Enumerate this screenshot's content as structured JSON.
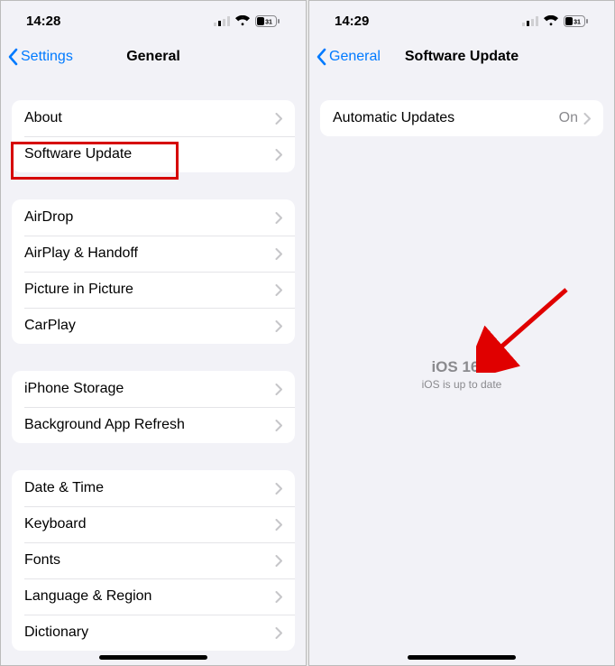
{
  "left": {
    "status": {
      "time": "14:28"
    },
    "nav": {
      "back": "Settings",
      "title": "General"
    },
    "groups": [
      [
        "About",
        "Software Update"
      ],
      [
        "AirDrop",
        "AirPlay & Handoff",
        "Picture in Picture",
        "CarPlay"
      ],
      [
        "iPhone Storage",
        "Background App Refresh"
      ],
      [
        "Date & Time",
        "Keyboard",
        "Fonts",
        "Language & Region",
        "Dictionary"
      ]
    ],
    "highlight_row": "Software Update"
  },
  "right": {
    "status": {
      "time": "14:29"
    },
    "nav": {
      "back": "General",
      "title": "Software Update"
    },
    "rows": [
      {
        "label": "Automatic Updates",
        "value": "On"
      }
    ],
    "update": {
      "version": "iOS 16.3",
      "message": "iOS is up to date"
    }
  },
  "battery_label": "31"
}
